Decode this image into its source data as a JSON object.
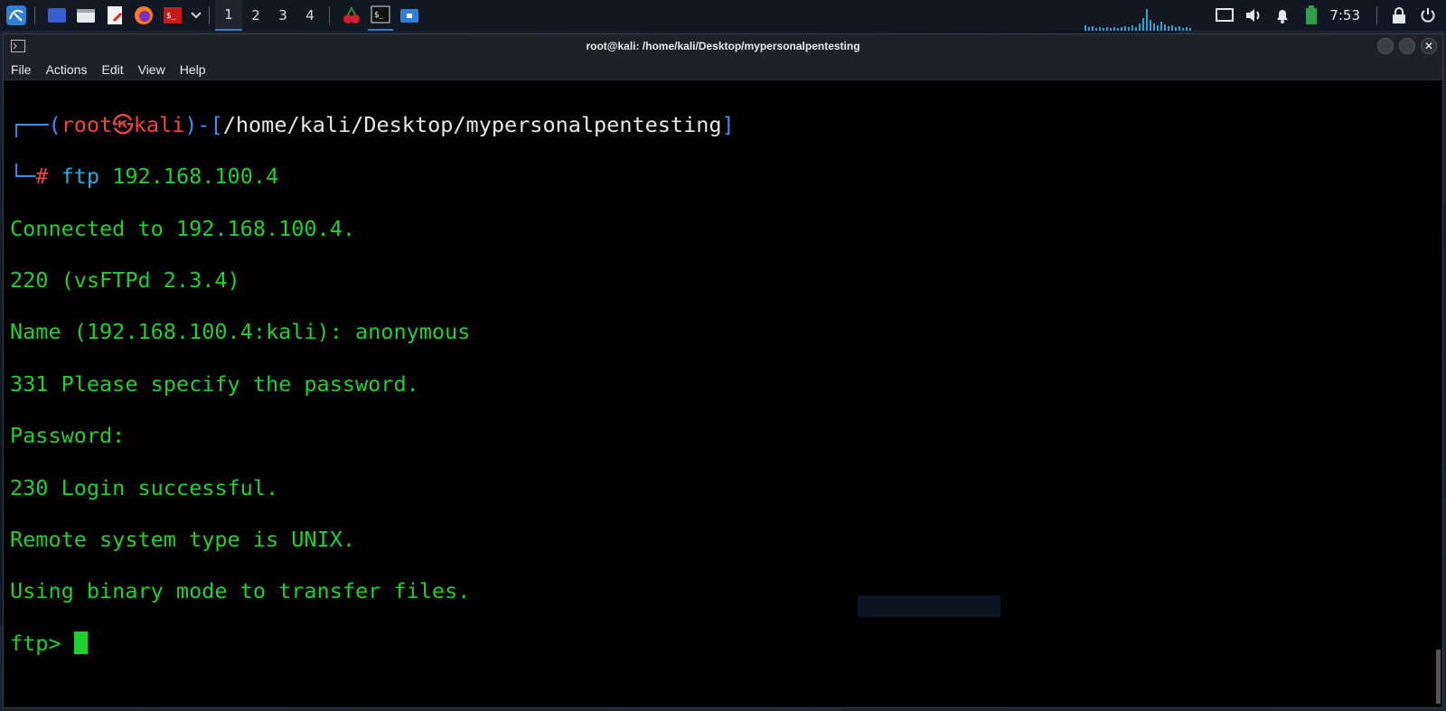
{
  "taskbar": {
    "workspaces": [
      "1",
      "2",
      "3",
      "4"
    ],
    "active_workspace": "1",
    "clock": "7:53",
    "icons": [
      "kali-menu-icon",
      "desktop-icon",
      "file-manager-icon",
      "text-editor-icon",
      "firefox-icon",
      "terminal-red-icon",
      "chevron-down-icon",
      "cherrytree-icon",
      "terminal-icon",
      "folder-icon"
    ],
    "tray_icons": [
      "display-icon",
      "volume-icon",
      "bell-icon",
      "battery-icon",
      "lock-icon",
      "power-icon"
    ]
  },
  "window": {
    "title": "root@kali: /home/kali/Desktop/mypersonalpentesting",
    "menu": [
      "File",
      "Actions",
      "Edit",
      "View",
      "Help"
    ]
  },
  "terminal": {
    "prompt_user": "root",
    "prompt_host": "kali",
    "prompt_path": "/home/kali/Desktop/mypersonalpentesting",
    "command_name": "ftp",
    "command_args": "192.168.100.4",
    "output": [
      "Connected to 192.168.100.4.",
      "220 (vsFTPd 2.3.4)",
      "Name (192.168.100.4:kali): anonymous",
      "331 Please specify the password.",
      "Password:",
      "230 Login successful.",
      "Remote system type is UNIX.",
      "Using binary mode to transfer files."
    ],
    "ftp_prompt": "ftp> "
  },
  "colors": {
    "terminal_text": "#1fd12b",
    "prompt_red": "#f0463c",
    "prompt_blue": "#3d8ff7",
    "accent": "#2f7ed8"
  }
}
